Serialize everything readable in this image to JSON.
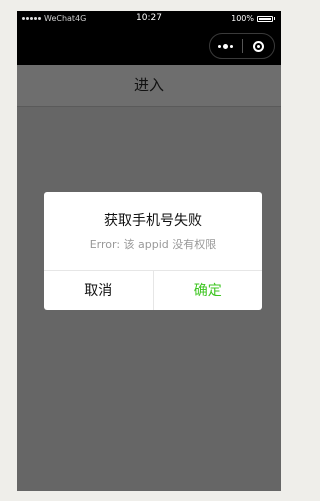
{
  "status_bar": {
    "carrier": "WeChat4G",
    "time": "10:27",
    "battery": "100%"
  },
  "nav": {
    "title": "进入"
  },
  "dialog": {
    "title": "获取手机号失败",
    "message": "Error: 该 appid 没有权限",
    "cancel_label": "取消",
    "confirm_label": "确定"
  },
  "colors": {
    "background": "#efeeea",
    "overlay": "#666666",
    "confirm": "#3cc51f"
  }
}
